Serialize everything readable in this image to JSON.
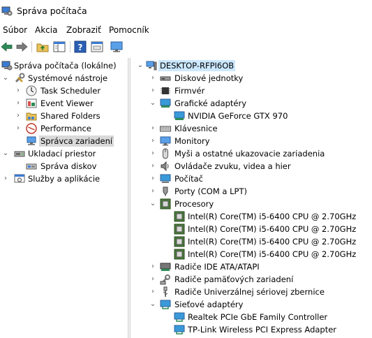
{
  "window": {
    "title": "Správa počítača",
    "icon": "computer-management-icon"
  },
  "menu": [
    "Súbor",
    "Akcia",
    "Zobraziť",
    "Pomocník"
  ],
  "toolbar": {
    "buttons": [
      "back-arrow-icon",
      "forward-arrow-icon",
      "up-folder-icon",
      "show-hide-tree-icon",
      "help-icon",
      "properties-icon",
      "monitor-icon"
    ]
  },
  "left_tree": {
    "root": "Správa počítača (lokálne)",
    "system_tools": "Systémové nástroje",
    "task_scheduler": "Task Scheduler",
    "event_viewer": "Event Viewer",
    "shared_folders": "Shared Folders",
    "performance": "Performance",
    "device_manager": "Správca zariadení",
    "storage": "Ukladací priestor",
    "disk_management": "Správa diskov",
    "services": "Služby a aplikácie"
  },
  "right_tree": {
    "computer": "DESKTOP-RFPI6OB",
    "disk_drives": "Diskové jednotky",
    "firmware": "Firmvér",
    "display_adapters": "Grafické adaptéry",
    "gpu": "NVIDIA GeForce GTX 970",
    "keyboards": "Klávesnice",
    "monitors": "Monitory",
    "mice": "Myši a ostatné ukazovacie zariadenia",
    "audio": "Ovládače zvuku, videa a hier",
    "computer_class": "Počítač",
    "ports": "Porty (COM a LPT)",
    "processors": "Procesory",
    "cpus": [
      "Intel(R) Core(TM) i5-6400 CPU @ 2.70GHz",
      "Intel(R) Core(TM) i5-6400 CPU @ 2.70GHz",
      "Intel(R) Core(TM) i5-6400 CPU @ 2.70GHz",
      "Intel(R) Core(TM) i5-6400 CPU @ 2.70GHz"
    ],
    "ide": "Radiče IDE ATA/ATAPI",
    "storage_controllers": "Radiče pamäťových zariadení",
    "usb": "Radiče Univerzálnej sériovej zbernice",
    "network_adapters": "Sieťové adaptéry",
    "nics": [
      "Realtek PCIe GbE Family Controller",
      "TP-Link Wireless PCI Express Adapter"
    ]
  }
}
